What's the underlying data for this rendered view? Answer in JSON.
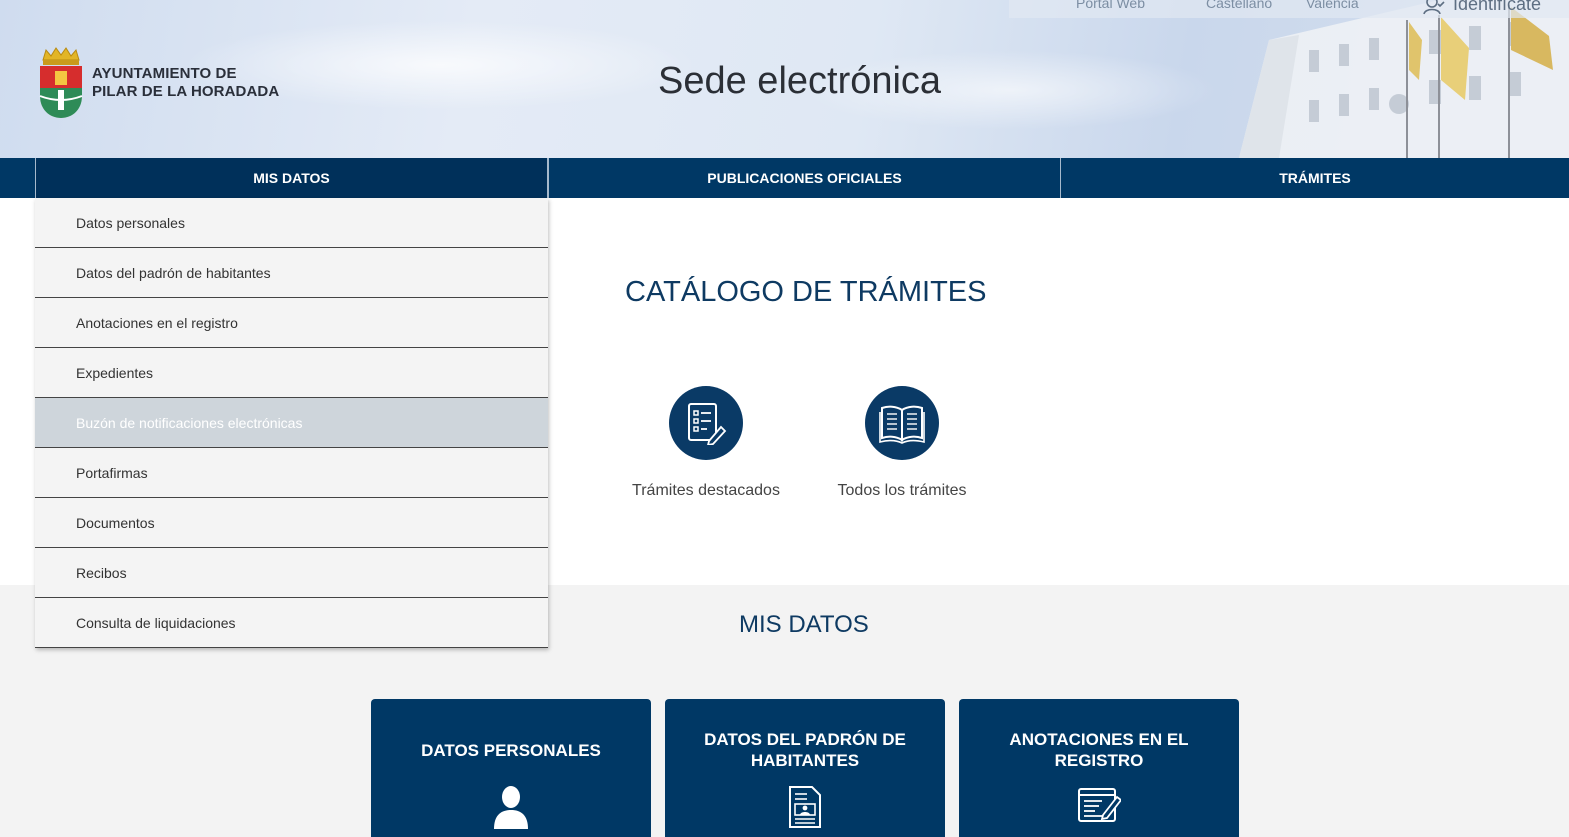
{
  "header": {
    "logo_line1": "AYUNTAMIENTO DE",
    "logo_line2": "PILAR DE LA HORADADA",
    "site_title": "Sede electrónica",
    "top_links": [
      "Portal Web",
      "Castellano",
      "Valencià"
    ],
    "login_label": "Identifícate"
  },
  "nav": {
    "items": [
      {
        "label": "MIS DATOS",
        "active": true
      },
      {
        "label": "PUBLICACIONES OFICIALES",
        "active": false
      },
      {
        "label": "TRÁMITES",
        "active": false
      }
    ]
  },
  "dropdown": {
    "items": [
      {
        "label": "Datos personales"
      },
      {
        "label": "Datos del padrón de habitantes"
      },
      {
        "label": "Anotaciones en el registro"
      },
      {
        "label": "Expedientes"
      },
      {
        "label": "Buzón de notificaciones electrónicas",
        "hover": true
      },
      {
        "label": "Portafirmas"
      },
      {
        "label": "Documentos"
      },
      {
        "label": "Recibos"
      },
      {
        "label": "Consulta de liquidaciones"
      }
    ]
  },
  "catalog": {
    "title": "CATÁLOGO DE TRÁMITES",
    "cards": [
      {
        "label": "Trámites destacados",
        "icon": "checklist-document-icon"
      },
      {
        "label": "Todos los trámites",
        "icon": "open-book-icon"
      }
    ]
  },
  "mis_datos": {
    "title": "MIS DATOS",
    "tiles": [
      {
        "label": "DATOS PERSONALES",
        "icon": "user-icon"
      },
      {
        "label": "DATOS DEL PADRÓN DE HABITANTES",
        "icon": "id-document-icon"
      },
      {
        "label": "ANOTACIONES EN EL REGISTRO",
        "icon": "register-edit-icon"
      }
    ]
  },
  "colors": {
    "primary": "#003865",
    "title_blue": "#0e3a62",
    "hover_gray": "#ced5db",
    "section_bg": "#f3f3f3"
  }
}
